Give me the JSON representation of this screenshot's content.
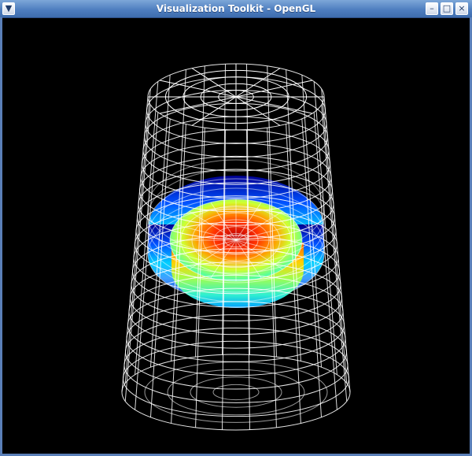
{
  "window": {
    "title": "Visualization Toolkit - OpenGL",
    "buttons": {
      "menu_icon": "chevron-down-icon",
      "minimize_icon": "minimize-icon",
      "maximize_icon": "maximize-icon",
      "close_icon": "close-icon"
    }
  },
  "scene": {
    "background": "#000000",
    "wireframe_color": "#ffffff",
    "colormap": [
      "#0000a0",
      "#0040ff",
      "#00c0ff",
      "#40ffc0",
      "#c0ff40",
      "#ffc000",
      "#ff4000",
      "#c00000"
    ]
  }
}
